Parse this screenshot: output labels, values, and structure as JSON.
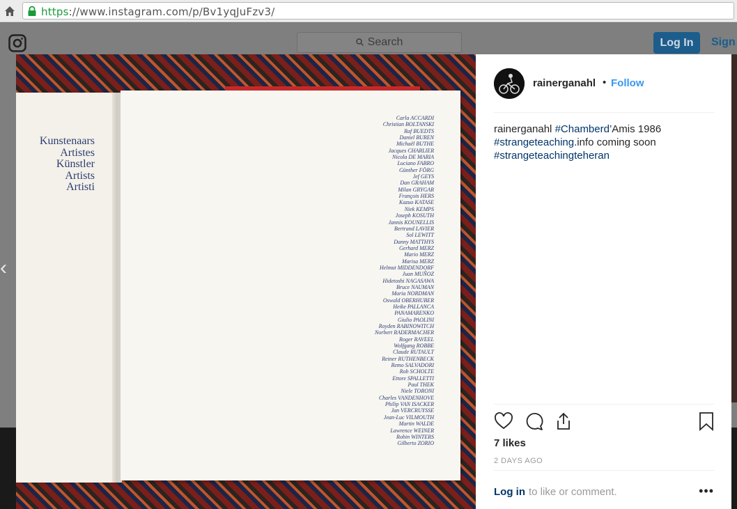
{
  "browser": {
    "url_scheme": "https",
    "url_rest": "://www.instagram.com/p/Bv1yqJuFzv3/"
  },
  "nav": {
    "search_placeholder": "Search",
    "login_label": "Log In",
    "signup_label": "Sign"
  },
  "book": {
    "languages": [
      "Kunstenaars",
      "Artistes",
      "Künstler",
      "Artists",
      "Artisti"
    ],
    "artists": [
      "Carla ACCARDI",
      "Christian BOLTANSKI",
      "Raf BUEDTS",
      "Daniel BUREN",
      "Michaël BUTHE",
      "Jacques CHARLIER",
      "Nicola DE MARIA",
      "Luciano FABRO",
      "Günther FÖRG",
      "Jef GEYS",
      "Dan GRAHAM",
      "Milan GRYGAR",
      "François HERS",
      "Kazuo KATASE",
      "Niek KEMPS",
      "Joseph KOSUTH",
      "Jannis KOUNELLIS",
      "Bertrand LAVIER",
      "Sol LEWITT",
      "Danny MATTHYS",
      "Gerhard MERZ",
      "Mario MERZ",
      "Marisa MERZ",
      "Helmut MIDDENDORF",
      "Juan MUÑOZ",
      "Hidetoshi NAGASAWA",
      "Bruce NAUMAN",
      "Maria NORDMAN",
      "Oswald OBERHUBER",
      "Heike PALLANCA",
      "PANAMARENKO",
      "Giulio PAOLINI",
      "Royden RABINOWITCH",
      "Norbert RADERMACHER",
      "Roger RAVEEL",
      "Wolfgang ROBBE",
      "Claude RUTAULT",
      "Reiner RUTHENBECK",
      "Remo SALVADORI",
      "Rob SCHOLTE",
      "Ettore SPALLETTI",
      "Paul THEK",
      "Niele TORONI",
      "Charles VANDENHOVE",
      "Philip VAN ISACKER",
      "Jan VERCRUYSSE",
      "Jean-Luc VILMOUTH",
      "Martin WALDE",
      "Lawrence WEINER",
      "Robin WINTERS",
      "Gilberto ZORIO"
    ]
  },
  "post": {
    "username": "rainerganahl",
    "dot": "•",
    "follow_label": "Follow",
    "caption": {
      "tag1": "#Chamberd",
      "text1": "’Amis 1986",
      "tag2": "#strangeteaching",
      "text2": ".info coming soon",
      "tag3": "#strangeteachingteheran"
    },
    "likes": "7 likes",
    "date": "2 DAYS AGO",
    "login_link": "Log in",
    "login_rest": "to like or comment.",
    "more": "•••"
  },
  "colors": {
    "link_blue": "#3897f0",
    "hashtag": "#003569",
    "login_button": "#1c5d8c",
    "book_ink": "#2c3d72"
  }
}
